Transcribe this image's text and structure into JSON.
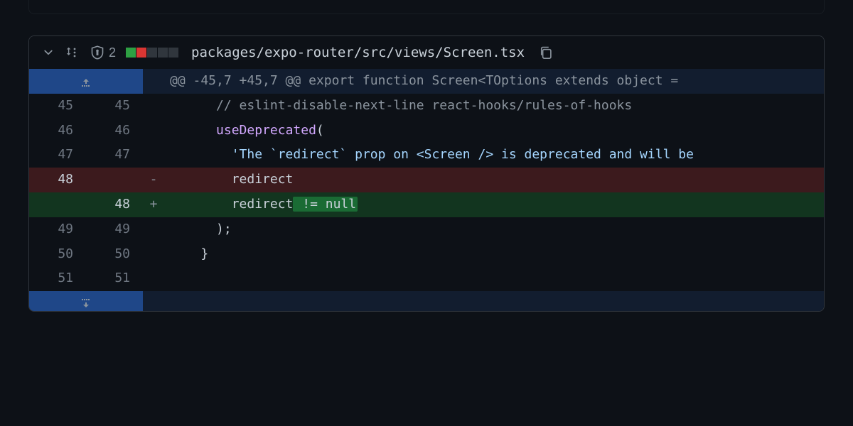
{
  "file": {
    "path": "packages/expo-router/src/views/Screen.tsx",
    "shield_count": "2",
    "diffstat": [
      "add",
      "del",
      "neutral",
      "neutral",
      "neutral"
    ]
  },
  "hunk_header": "@@ -45,7 +45,7 @@ export function Screen<TOptions extends object = ",
  "lines": [
    {
      "old": "45",
      "new": "45",
      "marker": "",
      "indent": "      ",
      "tokens": [
        {
          "cls": "tok-comment",
          "text": "// eslint-disable-next-line react-hooks/rules-of-hooks"
        }
      ]
    },
    {
      "old": "46",
      "new": "46",
      "marker": "",
      "indent": "      ",
      "tokens": [
        {
          "cls": "tok-fn",
          "text": "useDeprecated"
        },
        {
          "cls": "tok-plain",
          "text": "("
        }
      ]
    },
    {
      "old": "47",
      "new": "47",
      "marker": "",
      "indent": "        ",
      "tokens": [
        {
          "cls": "tok-str",
          "text": "'The `redirect` prop on <Screen /> is deprecated and will be "
        }
      ]
    },
    {
      "type": "del",
      "old": "48",
      "new": "",
      "marker": "-",
      "indent": "        ",
      "tokens": [
        {
          "cls": "tok-plain",
          "text": "redirect"
        }
      ]
    },
    {
      "type": "add",
      "old": "",
      "new": "48",
      "marker": "+",
      "indent": "        ",
      "tokens": [
        {
          "cls": "tok-plain",
          "text": "redirect"
        },
        {
          "cls": "inline-add",
          "text": " != null"
        }
      ]
    },
    {
      "old": "49",
      "new": "49",
      "marker": "",
      "indent": "      ",
      "tokens": [
        {
          "cls": "tok-plain",
          "text": ");"
        }
      ]
    },
    {
      "old": "50",
      "new": "50",
      "marker": "",
      "indent": "    ",
      "tokens": [
        {
          "cls": "tok-plain",
          "text": "}"
        }
      ]
    },
    {
      "old": "51",
      "new": "51",
      "marker": "",
      "indent": "",
      "tokens": []
    }
  ]
}
